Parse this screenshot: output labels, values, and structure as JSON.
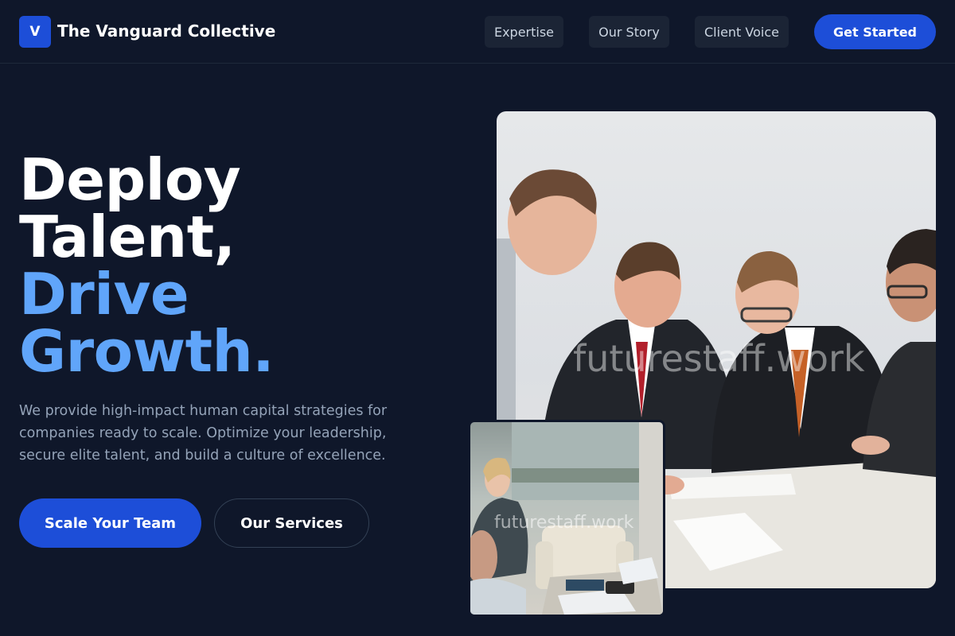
{
  "header": {
    "logo_letter": "V",
    "brand_name": "The Vanguard Collective",
    "nav": [
      "Expertise",
      "Our Story",
      "Client Voice"
    ],
    "cta_label": "Get Started"
  },
  "hero": {
    "headline_white": [
      "Deploy",
      "Talent,"
    ],
    "headline_blue": [
      "Drive",
      "Growth."
    ],
    "description": "We provide high-impact human capital strategies for companies ready to scale. Optimize your leadership, secure elite talent, and build a culture of excellence.",
    "primary_button": "Scale Your Team",
    "secondary_button": "Our Services"
  },
  "images": {
    "main_watermark": "futurestaff.work",
    "secondary_watermark": "futurestaff.work"
  },
  "colors": {
    "background": "#0f172a",
    "accent": "#1d4ed8",
    "headline_highlight": "#60a5fa",
    "muted_text": "#94a3b8"
  }
}
